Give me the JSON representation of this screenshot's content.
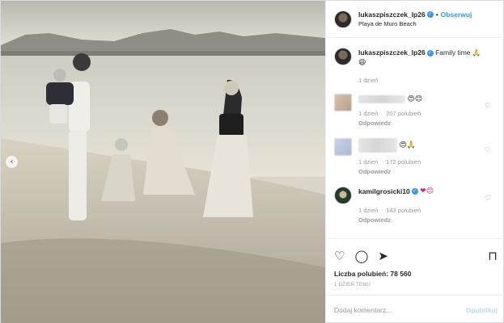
{
  "post": {
    "username": "lukaszpiszczek_lp26",
    "verified_glyph": "✓",
    "separator": "•",
    "follow_label": "Obserwuj",
    "location": "Playa de Muro Beach",
    "image_alt": "Family walking on beach, black and white"
  },
  "caption": {
    "username": "lukaszpiszczek_lp26",
    "text": "Family time 🙏",
    "emoji": "😄",
    "time": "1 dzień"
  },
  "comments": [
    {
      "emojis": "😍😊",
      "time": "1 dzień",
      "likes": "207 polubień",
      "reply": "Odpowiedz",
      "avatar_icon": "blurred-avatar"
    },
    {
      "emojis": "😍🙏",
      "time": "1 dzień",
      "likes": "172 polubień",
      "reply": "Odpowiedz",
      "avatar_icon": "blurred-avatar"
    },
    {
      "username": "kamilgrosicki10",
      "emojis": "❤😊",
      "time": "1 dzień",
      "likes": "143 polubień",
      "reply": "Odpowiedz",
      "avatar_icon": "user-avatar"
    }
  ],
  "actions": {
    "like_icon": "♡",
    "comment_icon": "◯",
    "share_icon": "➤",
    "bookmark_icon": "⊓",
    "heart_small": "♡",
    "likes_label": "Liczba polubień: 78 560",
    "date": "1 DZIEŃ TEMU"
  },
  "add_comment": {
    "placeholder": "Dodaj komentarz...",
    "publish": "Opublikuj"
  },
  "nav": {
    "prev_glyph": "‹"
  }
}
